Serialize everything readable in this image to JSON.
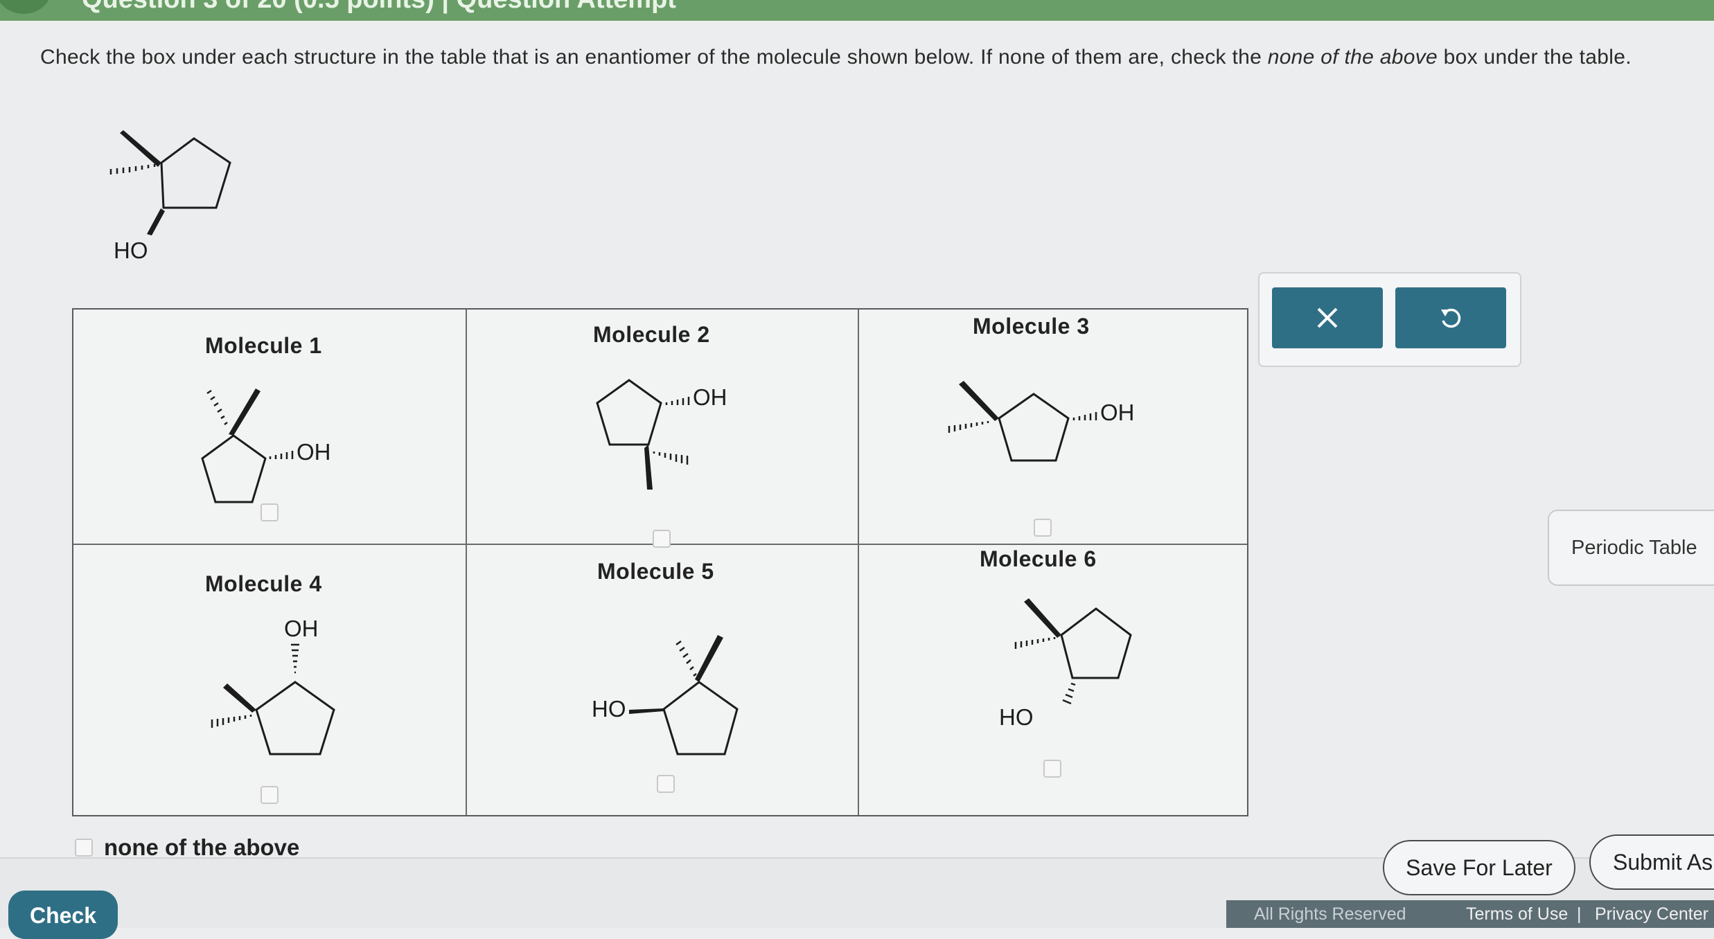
{
  "header": {
    "question_title": "Question 3 of 20 (0.5 points) | Question Attempt"
  },
  "prompt": {
    "part1": "Check the box under each structure in the table that is an enantiomer of the molecule shown below. If none of them are, check the ",
    "italic": "none of the above",
    "part2": " box under the table."
  },
  "reference_molecule": {
    "label": "HO"
  },
  "molecules": [
    {
      "title": "Molecule 1",
      "oh": "OH"
    },
    {
      "title": "Molecule 2",
      "oh": "OH"
    },
    {
      "title": "Molecule 3",
      "oh": "OH"
    },
    {
      "title": "Molecule 4",
      "oh": "OH"
    },
    {
      "title": "Molecule 5",
      "oh": "HO"
    },
    {
      "title": "Molecule 6",
      "oh": "HO"
    }
  ],
  "none_of_the_above": "none of the above",
  "tools": {
    "clear_icon": "close-icon",
    "undo_icon": "undo-icon"
  },
  "periodic_table": "Periodic Table",
  "buttons": {
    "check": "Check",
    "save_for_later": "Save For Later",
    "submit": "Submit As"
  },
  "footer": {
    "rights": "All Rights Reserved",
    "terms": "Terms of Use",
    "separator": "|",
    "privacy": "Privacy Center"
  },
  "colors": {
    "header_green": "#6a9e68",
    "accent_teal": "#2f6f86"
  }
}
